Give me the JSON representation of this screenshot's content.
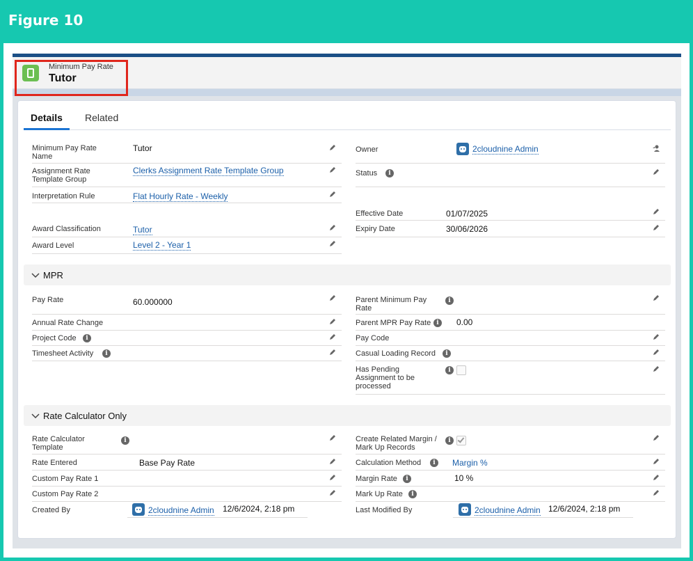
{
  "figure_title": "Figure 10",
  "record": {
    "object_label": "Minimum Pay Rate",
    "name": "Tutor"
  },
  "tabs": [
    "Details",
    "Related"
  ],
  "details": {
    "min_pay_rate_name_label": "Minimum Pay Rate Name",
    "min_pay_rate_name_value": "Tutor",
    "assignment_rate_template_group_label": "Assignment Rate Template Group",
    "assignment_rate_template_group_value": "Clerks Assignment Rate Template Group",
    "interpretation_rule_label": "Interpretation Rule",
    "interpretation_rule_value": "Flat Hourly Rate - Weekly",
    "award_classification_label": "Award Classification",
    "award_classification_value": "Tutor",
    "award_level_label": "Award Level",
    "award_level_value": "Level 2 - Year 1",
    "owner_label": "Owner",
    "owner_value": "2cloudnine Admin",
    "status_label": "Status",
    "effective_date_label": "Effective Date",
    "effective_date_value": "01/07/2025",
    "expiry_date_label": "Expiry Date",
    "expiry_date_value": "30/06/2026"
  },
  "mpr": {
    "title": "MPR",
    "pay_rate_label": "Pay Rate",
    "pay_rate_value": "60.000000",
    "annual_rate_change_label": "Annual Rate Change",
    "project_code_label": "Project Code",
    "timesheet_activity_label": "Timesheet Activity",
    "parent_min_pay_rate_label": "Parent Minimum Pay Rate",
    "parent_mpr_pay_rate_label": "Parent MPR Pay Rate",
    "parent_mpr_pay_rate_value": "0.00",
    "pay_code_label": "Pay Code",
    "casual_loading_record_label": "Casual Loading Record",
    "has_pending_label": "Has Pending Assignment to be processed"
  },
  "rate_calc": {
    "title": "Rate Calculator Only",
    "rate_calculator_template_label": "Rate Calculator Template",
    "rate_entered_label": "Rate Entered",
    "rate_entered_value": "Base Pay Rate",
    "custom_pay_rate_1_label": "Custom Pay Rate 1",
    "custom_pay_rate_2_label": "Custom Pay Rate 2",
    "created_by_label": "Created By",
    "created_by_user": "2cloudnine Admin",
    "created_by_date": "12/6/2024, 2:18 pm",
    "create_related_margin_label": "Create Related Margin / Mark Up Records",
    "calculation_method_label": "Calculation Method",
    "calculation_method_value": "Margin %",
    "margin_rate_label": "Margin Rate",
    "margin_rate_value": "10 %",
    "mark_up_rate_label": "Mark Up Rate",
    "last_modified_by_label": "Last Modified By",
    "last_modified_by_user": "2cloudnine Admin",
    "last_modified_by_date": "12/6/2024, 2:18 pm"
  },
  "colors": {
    "frame": "#16c8b0",
    "highlight": "#e0261c",
    "link": "#1b5fa9",
    "record_icon": "#6cbf52"
  }
}
